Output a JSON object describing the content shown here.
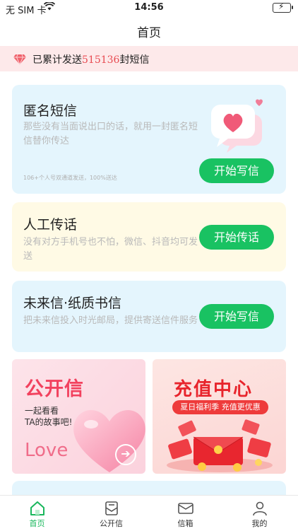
{
  "status_bar": {
    "carrier": "无 SIM 卡",
    "time": "14:56"
  },
  "nav": {
    "title": "首页"
  },
  "notice": {
    "prefix": "已累计发送",
    "count": "515136",
    "suffix": "封短信"
  },
  "cards": [
    {
      "title": "匿名短信",
      "desc": "那些没有当面说出口的话，就用一封匿名短信替你传达",
      "footnote": "106+个人号双通道发送，100%送达",
      "button": "开始写信"
    },
    {
      "title": "人工传话",
      "desc": "没有对方手机号也不怕，微信、抖音均可发送",
      "button": "开始传话"
    },
    {
      "title": "未来信·纸质书信",
      "desc": "把未来信投入时光邮局，提供寄送信件服务",
      "button": "开始写信"
    }
  ],
  "banners": {
    "left": {
      "title": "公开信",
      "line1": "一起看看",
      "line2": "TA的故事吧!",
      "word": "Love"
    },
    "right": {
      "title": "充值中心",
      "tagline": "夏日福利季 充值更优惠"
    }
  },
  "tabbar": {
    "items": [
      {
        "label": "首页",
        "icon": "home-icon",
        "active": true
      },
      {
        "label": "公开信",
        "icon": "open-letter-icon",
        "active": false
      },
      {
        "label": "信箱",
        "icon": "mailbox-icon",
        "active": false
      },
      {
        "label": "我的",
        "icon": "profile-icon",
        "active": false
      }
    ]
  },
  "colors": {
    "accent_green": "#19c262",
    "notice_bg": "#fde9ea",
    "count_red": "#e84b52",
    "card_blue": "#e4f5fd",
    "card_yellow": "#fffae5"
  }
}
